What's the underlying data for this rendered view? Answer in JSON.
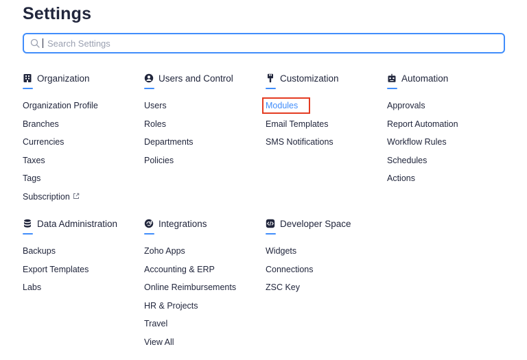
{
  "page": {
    "title": "Settings"
  },
  "search": {
    "placeholder": "Search Settings",
    "value": ""
  },
  "sections": {
    "organization": {
      "title": "Organization",
      "icon": "building-icon",
      "items": [
        "Organization Profile",
        "Branches",
        "Currencies",
        "Taxes",
        "Tags",
        "Subscription"
      ]
    },
    "users_control": {
      "title": "Users and Control",
      "icon": "user-circle-icon",
      "items": [
        "Users",
        "Roles",
        "Departments",
        "Policies"
      ]
    },
    "customization": {
      "title": "Customization",
      "icon": "brush-icon",
      "items": [
        "Modules",
        "Email Templates",
        "SMS Notifications"
      ],
      "selected": "Modules"
    },
    "automation": {
      "title": "Automation",
      "icon": "robot-icon",
      "items": [
        "Approvals",
        "Report Automation",
        "Workflow Rules",
        "Schedules",
        "Actions"
      ]
    },
    "data_admin": {
      "title": "Data Administration",
      "icon": "database-icon",
      "items": [
        "Backups",
        "Export Templates",
        "Labs"
      ]
    },
    "integrations": {
      "title": "Integrations",
      "icon": "integrations-icon",
      "items": [
        "Zoho Apps",
        "Accounting & ERP",
        "Online Reimbursements",
        "HR & Projects",
        "Travel",
        "View All"
      ]
    },
    "developer": {
      "title": "Developer Space",
      "icon": "code-icon",
      "items": [
        "Widgets",
        "Connections",
        "ZSC Key"
      ]
    }
  },
  "colors": {
    "accent": "#408dfb",
    "highlight": "#e43b21",
    "text": "#21263c"
  }
}
